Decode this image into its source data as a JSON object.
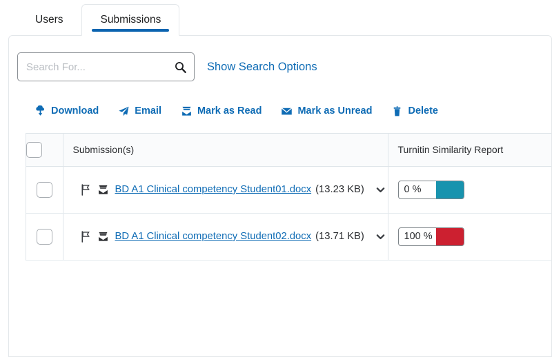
{
  "colors": {
    "accent_blue": "#0f6cb5",
    "tab_underline": "#0b64b0",
    "teal": "#1893ae",
    "red": "#cc2030",
    "border": "#dfe5ea"
  },
  "tabs": [
    {
      "label": "Users",
      "active": false,
      "name": "tab-users"
    },
    {
      "label": "Submissions",
      "active": true,
      "name": "tab-submissions"
    }
  ],
  "search": {
    "value": "",
    "placeholder": "Search For...",
    "icon": "search-icon",
    "show_options_label": "Show Search Options"
  },
  "toolbar": {
    "actions": [
      {
        "label": "Download",
        "icon": "cloud-download-icon",
        "name": "download-button"
      },
      {
        "label": "Email",
        "icon": "paper-plane-icon",
        "name": "email-button"
      },
      {
        "label": "Mark as Read",
        "icon": "inbox-down-icon",
        "name": "mark-as-read-button"
      },
      {
        "label": "Mark as Unread",
        "icon": "envelope-icon",
        "name": "mark-as-unread-button"
      },
      {
        "label": "Delete",
        "icon": "trash-icon",
        "name": "delete-button"
      }
    ]
  },
  "table": {
    "columns": {
      "select_all": "",
      "submissions": "Submission(s)",
      "turnitin": "Turnitin Similarity Report"
    },
    "rows": [
      {
        "selected": false,
        "flag_icon": "flag-outline-icon",
        "inbox_icon": "inbox-down-icon",
        "file_name": "BD A1 Clinical competency Student01.docx",
        "file_size": "(13.23 KB)",
        "expand_icon": "chevron-down-icon",
        "similarity": {
          "value": "0 %",
          "color": "#1893ae"
        }
      },
      {
        "selected": false,
        "flag_icon": "flag-outline-icon",
        "inbox_icon": "inbox-down-icon",
        "file_name": "BD A1 Clinical competency Student02.docx",
        "file_size": "(13.71 KB)",
        "expand_icon": "chevron-down-icon",
        "similarity": {
          "value": "100 %",
          "color": "#cc2030"
        }
      }
    ]
  }
}
